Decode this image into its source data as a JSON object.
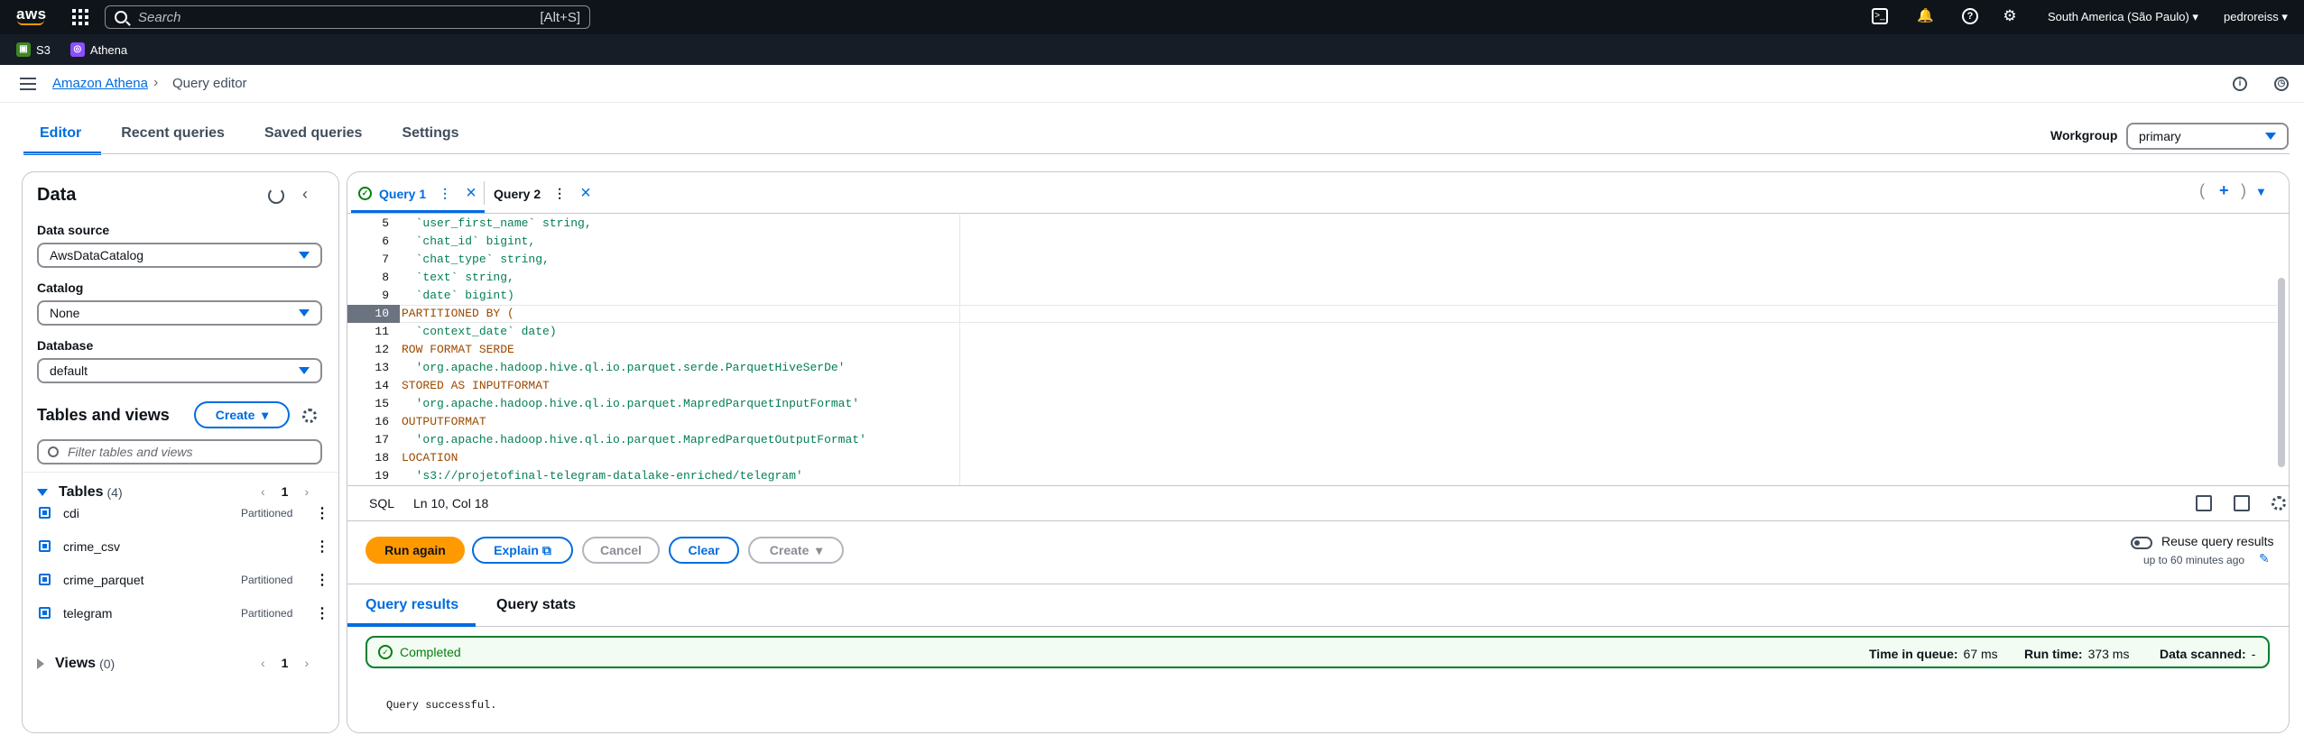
{
  "topbar": {
    "logo": "aws",
    "search_placeholder": "Search",
    "search_shortcut": "[Alt+S]",
    "region": "South America (São Paulo)",
    "user": "pedroreiss"
  },
  "services": [
    {
      "label": "S3",
      "color": "#3f8624"
    },
    {
      "label": "Athena",
      "color": "#8c4fff"
    }
  ],
  "breadcrumb": {
    "parent": "Amazon Athena",
    "current": "Query editor"
  },
  "tabs": [
    "Editor",
    "Recent queries",
    "Saved queries",
    "Settings"
  ],
  "workgroup": {
    "label": "Workgroup",
    "value": "primary"
  },
  "data_panel": {
    "title": "Data",
    "data_source_label": "Data source",
    "data_source": "AwsDataCatalog",
    "catalog_label": "Catalog",
    "catalog": "None",
    "database_label": "Database",
    "database": "default",
    "tables_views_title": "Tables and views",
    "create_label": "Create",
    "filter_placeholder": "Filter tables and views",
    "tables_label": "Tables",
    "tables_count": "(4)",
    "tables_page": "1",
    "tables": [
      {
        "name": "cdi",
        "badge": "Partitioned"
      },
      {
        "name": "crime_csv",
        "badge": ""
      },
      {
        "name": "crime_parquet",
        "badge": "Partitioned"
      },
      {
        "name": "telegram",
        "badge": "Partitioned"
      }
    ],
    "views_label": "Views",
    "views_count": "(0)",
    "views_page": "1"
  },
  "query_tabs": [
    {
      "label": "Query 1",
      "active": true
    },
    {
      "label": "Query 2",
      "active": false
    }
  ],
  "code": {
    "line_numbers": [
      "5",
      "6",
      "7",
      "8",
      "9",
      "10",
      "11",
      "12",
      "13",
      "14",
      "15",
      "16",
      "17",
      "18",
      "19"
    ],
    "current_line": "10",
    "lines": [
      "  `user_first_name` string,",
      "  `chat_id` bigint,",
      "  `chat_type` string,",
      "  `text` string,",
      "  `date` bigint)",
      "PARTITIONED BY (",
      "  `context_date` date)",
      "ROW FORMAT SERDE",
      "  'org.apache.hadoop.hive.ql.io.parquet.serde.ParquetHiveSerDe'",
      "STORED AS INPUTFORMAT",
      "  'org.apache.hadoop.hive.ql.io.parquet.MapredParquetInputFormat'",
      "OUTPUTFORMAT",
      "  'org.apache.hadoop.hive.ql.io.parquet.MapredParquetOutputFormat'",
      "LOCATION",
      "  's3://projetofinal-telegram-datalake-enriched/telegram'"
    ]
  },
  "status": {
    "lang": "SQL",
    "position": "Ln 10, Col 18"
  },
  "actions": {
    "run": "Run again",
    "explain": "Explain",
    "cancel": "Cancel",
    "clear": "Clear",
    "create": "Create",
    "reuse": "Reuse query results",
    "reuse_sub": "up to 60 minutes ago"
  },
  "results": {
    "tab_results": "Query results",
    "tab_stats": "Query stats",
    "status": "Completed",
    "queue_label": "Time in queue:",
    "queue_value": "67 ms",
    "run_label": "Run time:",
    "run_value": "373 ms",
    "scanned_label": "Data scanned:",
    "scanned_value": "-",
    "message": "Query successful."
  }
}
